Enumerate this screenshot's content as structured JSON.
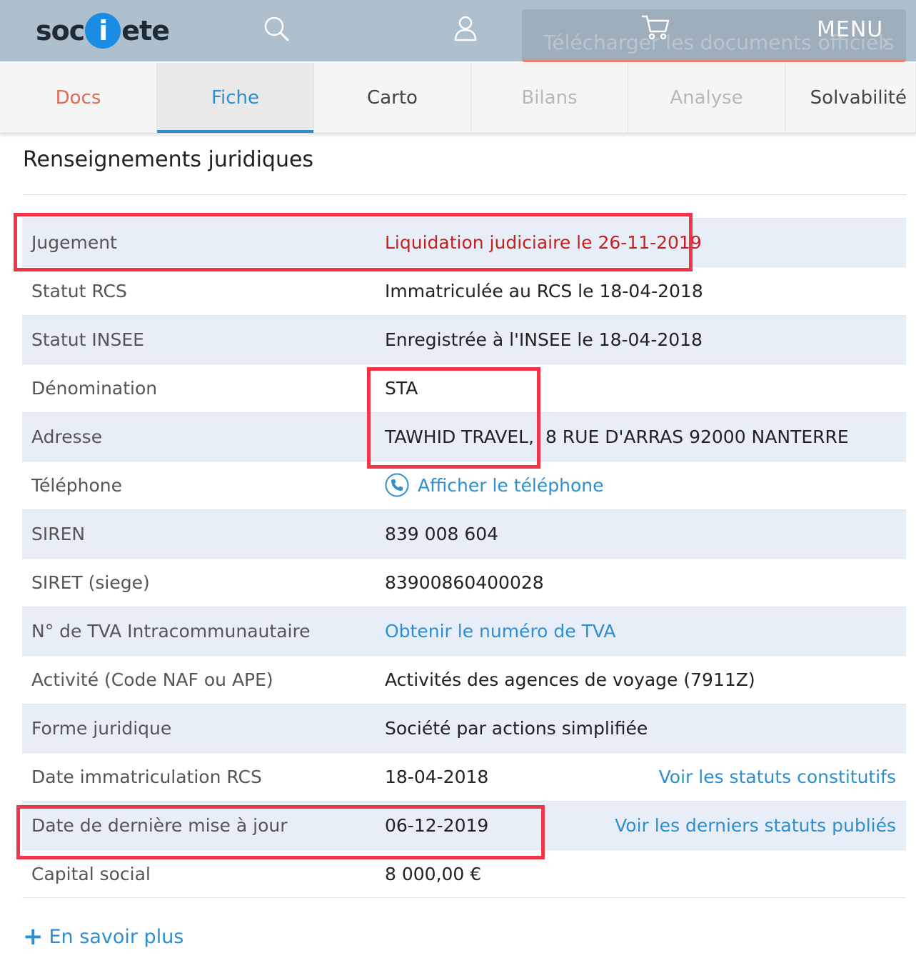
{
  "header": {
    "logo_before": "soc",
    "logo_dot": "i",
    "logo_after": "ete",
    "download_label": "Télécharger les documents officiels",
    "download_chevron": "›",
    "menu_label": "MENU",
    "icons": [
      "search-icon",
      "user-icon",
      "cart-icon"
    ]
  },
  "tabs": [
    {
      "label": "Docs"
    },
    {
      "label": "Fiche"
    },
    {
      "label": "Carto"
    },
    {
      "label": "Bilans"
    },
    {
      "label": "Analyse"
    },
    {
      "label": "Solvabilité"
    }
  ],
  "section": {
    "title": "Renseignements juridiques",
    "rows": [
      {
        "label": "Jugement",
        "value": "Liquidation judiciaire le 26-11-2019"
      },
      {
        "label": "Statut RCS",
        "value": "Immatriculée au RCS le 18-04-2018"
      },
      {
        "label": "Statut INSEE",
        "value": "Enregistrée à l'INSEE le 18-04-2018"
      },
      {
        "label": "Dénomination",
        "value": "STA"
      },
      {
        "label": "Adresse",
        "value": "TAWHID TRAVEL,  8 RUE D'ARRAS 92000 NANTERRE"
      },
      {
        "label": "Téléphone",
        "value": "Afficher le téléphone"
      },
      {
        "label": "SIREN",
        "value": "839 008 604"
      },
      {
        "label": "SIRET (siege)",
        "value": "83900860400028"
      },
      {
        "label": "N° de TVA Intracommunautaire",
        "value": "Obtenir le numéro de TVA"
      },
      {
        "label": "Activité (Code NAF ou APE)",
        "value": "Activités des agences de voyage (7911Z)"
      },
      {
        "label": "Forme juridique",
        "value": "Société par actions simplifiée"
      },
      {
        "label": "Date immatriculation RCS",
        "value": "18-04-2018",
        "link": "Voir les statuts constitutifs"
      },
      {
        "label": "Date de dernière mise à jour",
        "value": "06-12-2019",
        "link": "Voir les derniers statuts publiés"
      },
      {
        "label": "Capital social",
        "value": "8 000,00 €"
      }
    ],
    "more_icon": "+",
    "more_label": "En savoir plus"
  },
  "colors": {
    "header_bg": "#aebfcd",
    "accent_blue": "#2e8fd0",
    "judgement_red": "#c8201f",
    "highlight_red": "#f03549",
    "row_alt_bg": "#e8eef7"
  }
}
